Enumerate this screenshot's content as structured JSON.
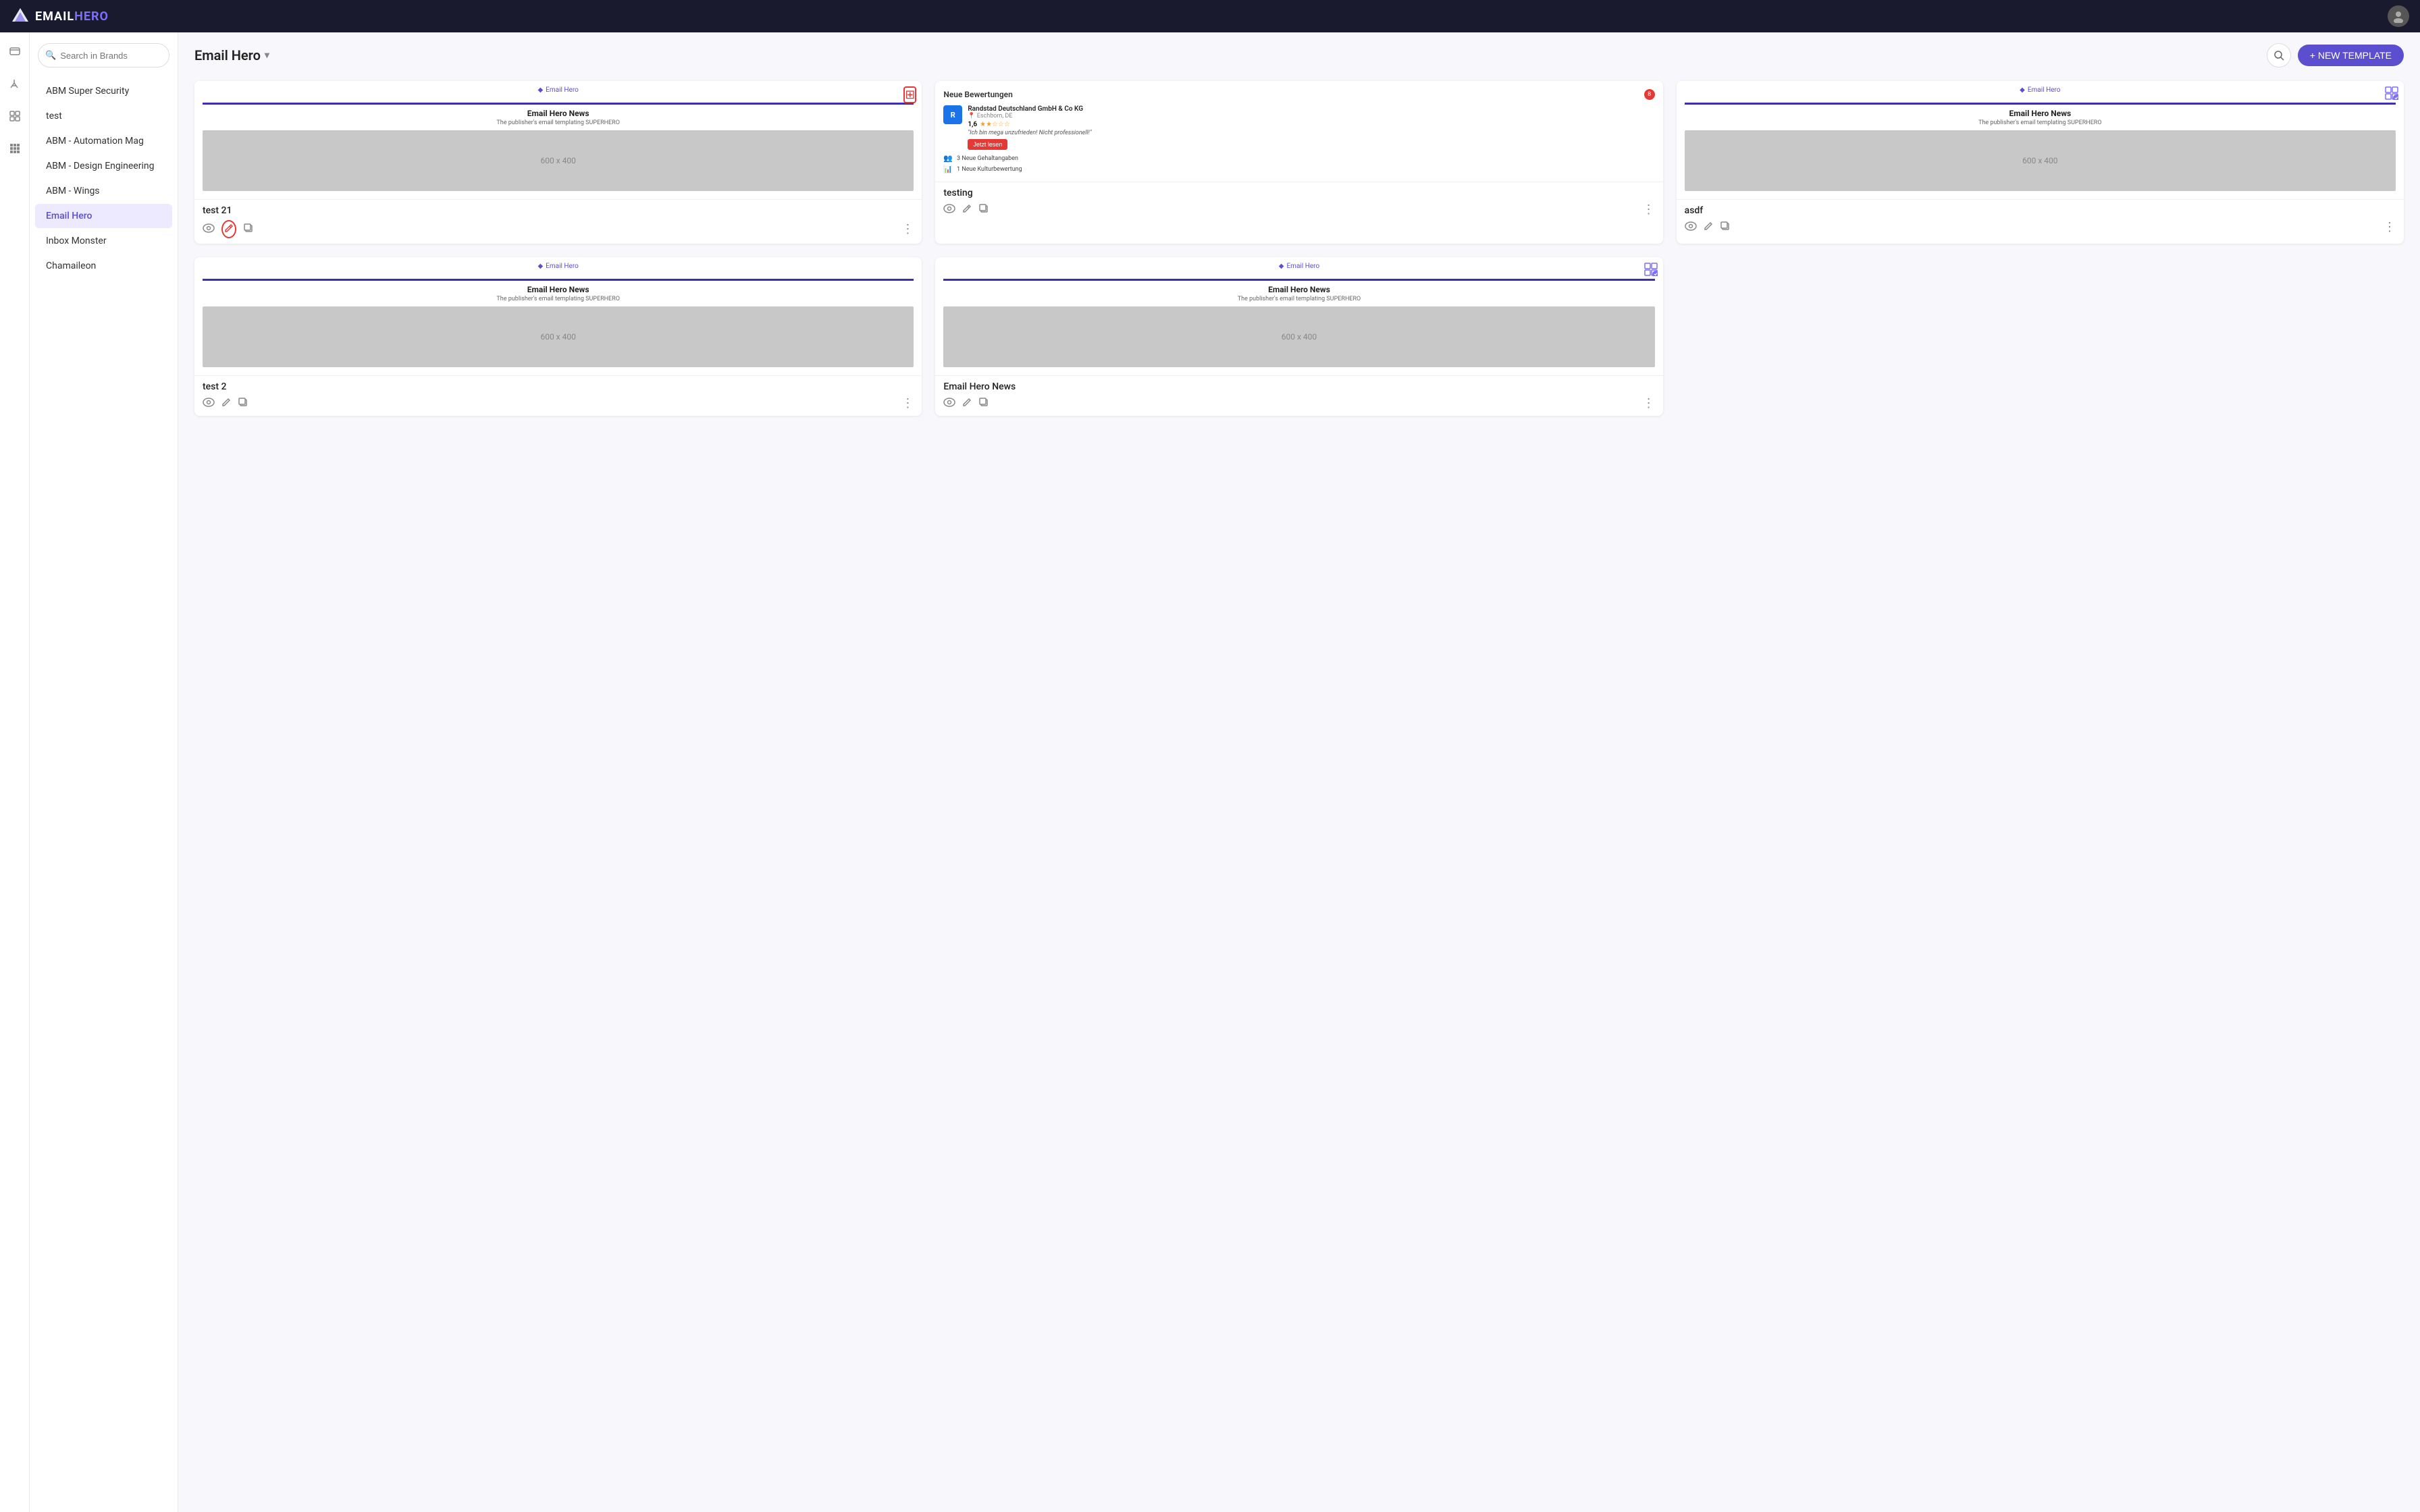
{
  "app": {
    "name_email": "EMAIL",
    "name_hero": "HERO"
  },
  "topnav": {
    "logo_text": "EMAILHERO"
  },
  "sidebar": {
    "search_placeholder": "Search in Brands",
    "brands": [
      {
        "id": "abm-super-security",
        "label": "ABM Super Security",
        "active": false
      },
      {
        "id": "test",
        "label": "test",
        "active": false
      },
      {
        "id": "abm-automation-mag",
        "label": "ABM - Automation Mag",
        "active": false
      },
      {
        "id": "abm-design-engineering",
        "label": "ABM - Design Engineering",
        "active": false
      },
      {
        "id": "abm-wings",
        "label": "ABM - Wings",
        "active": false
      },
      {
        "id": "email-hero",
        "label": "Email Hero",
        "active": true
      },
      {
        "id": "inbox-monster",
        "label": "Inbox Monster",
        "active": false
      },
      {
        "id": "chamaileon",
        "label": "Chamaileon",
        "active": false
      }
    ]
  },
  "main": {
    "brand_title": "Email Hero",
    "new_template_label": "+ NEW TEMPLATE",
    "templates": [
      {
        "id": "test-21",
        "badge_text": "Email Hero",
        "thumbnail_title": "Email Hero News",
        "thumbnail_subtitle": "The publisher's email templating SUPERHERO",
        "image_label": "600 x 400",
        "name": "test 21",
        "has_settings_active": true,
        "settings_active_color": "red",
        "edit_active": true
      },
      {
        "id": "testing",
        "badge_text": null,
        "thumbnail_title": null,
        "thumbnail_subtitle": null,
        "image_label": null,
        "name": "testing",
        "has_settings_active": false,
        "is_bewertungen": true
      },
      {
        "id": "asdf",
        "badge_text": "Email Hero",
        "thumbnail_title": "Email Hero News",
        "thumbnail_subtitle": "The publisher's email templating SUPERHERO",
        "image_label": "600 x 400",
        "name": "asdf",
        "has_settings_active": true,
        "settings_active_color": "purple"
      },
      {
        "id": "test-2",
        "badge_text": "Email Hero",
        "thumbnail_title": "Email Hero News",
        "thumbnail_subtitle": "The publisher's email templating SUPERHERO",
        "image_label": "600 x 400",
        "name": "test 2",
        "has_settings_active": false
      },
      {
        "id": "email-hero-news",
        "badge_text": "Email Hero",
        "thumbnail_title": "Email Hero News",
        "thumbnail_subtitle": "The publisher's email templating SUPERHERO",
        "image_label": "600 x 400",
        "name": "Email Hero News",
        "has_settings_active": true,
        "settings_active_color": "purple"
      }
    ],
    "bewertungen": {
      "header": "Neue Bewertungen",
      "notification_count": "8",
      "company_name": "Randstad Deutschland GmbH & Co KG",
      "company_location": "Eschborn, DE",
      "rating": "1,6",
      "stars": "★★☆☆☆",
      "review_quote": "\"Ich bin mega unzufrieden! Nicht professionell!\"",
      "action_btn": "Jetzt lesen",
      "stat1_count": "3",
      "stat1_label": "Neue Gehaltangaben",
      "stat2_count": "1",
      "stat2_label": "Neue Kulturbewertung"
    }
  },
  "icons": {
    "search": "🔍",
    "add": "+",
    "chevron_down": "▾",
    "eye": "👁",
    "edit": "✏",
    "copy": "⧉",
    "more": "⋮",
    "grid_settings": "⊞",
    "diamond": "◆",
    "people": "👥",
    "chart": "📊"
  }
}
